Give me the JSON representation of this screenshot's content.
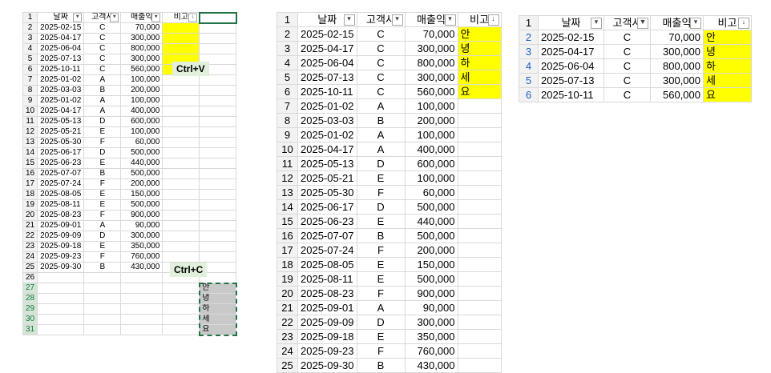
{
  "headers": [
    "날짜",
    "고객사",
    "매출액",
    "비고"
  ],
  "headers_cut": [
    "날짜",
    "고객사",
    "매출익",
    "비고"
  ],
  "filter_glyph": "▾",
  "sort_glyph": "↓",
  "filter_funnel_glyph": "▼",
  "rows": [
    {
      "date": "2025-02-15",
      "cust": "C",
      "amt": "70,000",
      "note": "안"
    },
    {
      "date": "2025-04-17",
      "cust": "C",
      "amt": "300,000",
      "note": "녕"
    },
    {
      "date": "2025-06-04",
      "cust": "C",
      "amt": "800,000",
      "note": "하"
    },
    {
      "date": "2025-07-13",
      "cust": "C",
      "amt": "300,000",
      "note": "세"
    },
    {
      "date": "2025-10-11",
      "cust": "C",
      "amt": "560,000",
      "note": "요"
    },
    {
      "date": "2025-01-02",
      "cust": "A",
      "amt": "100,000",
      "note": ""
    },
    {
      "date": "2025-03-03",
      "cust": "B",
      "amt": "200,000",
      "note": ""
    },
    {
      "date": "2025-01-02",
      "cust": "A",
      "amt": "100,000",
      "note": ""
    },
    {
      "date": "2025-04-17",
      "cust": "A",
      "amt": "400,000",
      "note": ""
    },
    {
      "date": "2025-05-13",
      "cust": "D",
      "amt": "600,000",
      "note": ""
    },
    {
      "date": "2025-05-21",
      "cust": "E",
      "amt": "100,000",
      "note": ""
    },
    {
      "date": "2025-05-30",
      "cust": "F",
      "amt": "60,000",
      "note": ""
    },
    {
      "date": "2025-06-17",
      "cust": "D",
      "amt": "500,000",
      "note": ""
    },
    {
      "date": "2025-06-23",
      "cust": "E",
      "amt": "440,000",
      "note": ""
    },
    {
      "date": "2025-07-07",
      "cust": "B",
      "amt": "500,000",
      "note": ""
    },
    {
      "date": "2025-07-24",
      "cust": "F",
      "amt": "200,000",
      "note": ""
    },
    {
      "date": "2025-08-05",
      "cust": "E",
      "amt": "150,000",
      "note": ""
    },
    {
      "date": "2025-08-11",
      "cust": "E",
      "amt": "500,000",
      "note": ""
    },
    {
      "date": "2025-08-23",
      "cust": "F",
      "amt": "900,000",
      "note": ""
    },
    {
      "date": "2025-09-01",
      "cust": "A",
      "amt": "90,000",
      "note": ""
    },
    {
      "date": "2025-09-09",
      "cust": "D",
      "amt": "300,000",
      "note": ""
    },
    {
      "date": "2025-09-18",
      "cust": "E",
      "amt": "350,000",
      "note": ""
    },
    {
      "date": "2025-09-23",
      "cust": "F",
      "amt": "760,000",
      "note": ""
    },
    {
      "date": "2025-09-30",
      "cust": "B",
      "amt": "430,000",
      "note": ""
    }
  ],
  "clipboard_rows": [
    {
      "row": "26",
      "note": ""
    },
    {
      "row": "27",
      "note": "안"
    },
    {
      "row": "28",
      "note": "녕"
    },
    {
      "row": "29",
      "note": "하"
    },
    {
      "row": "30",
      "note": "세"
    },
    {
      "row": "31",
      "note": "요"
    }
  ],
  "labels": {
    "paste": "Ctrl+V",
    "copy": "Ctrl+C"
  },
  "colors": {
    "highlight": "#ffff00",
    "copy_border": "#217346",
    "label_bg": "#e2efda"
  }
}
